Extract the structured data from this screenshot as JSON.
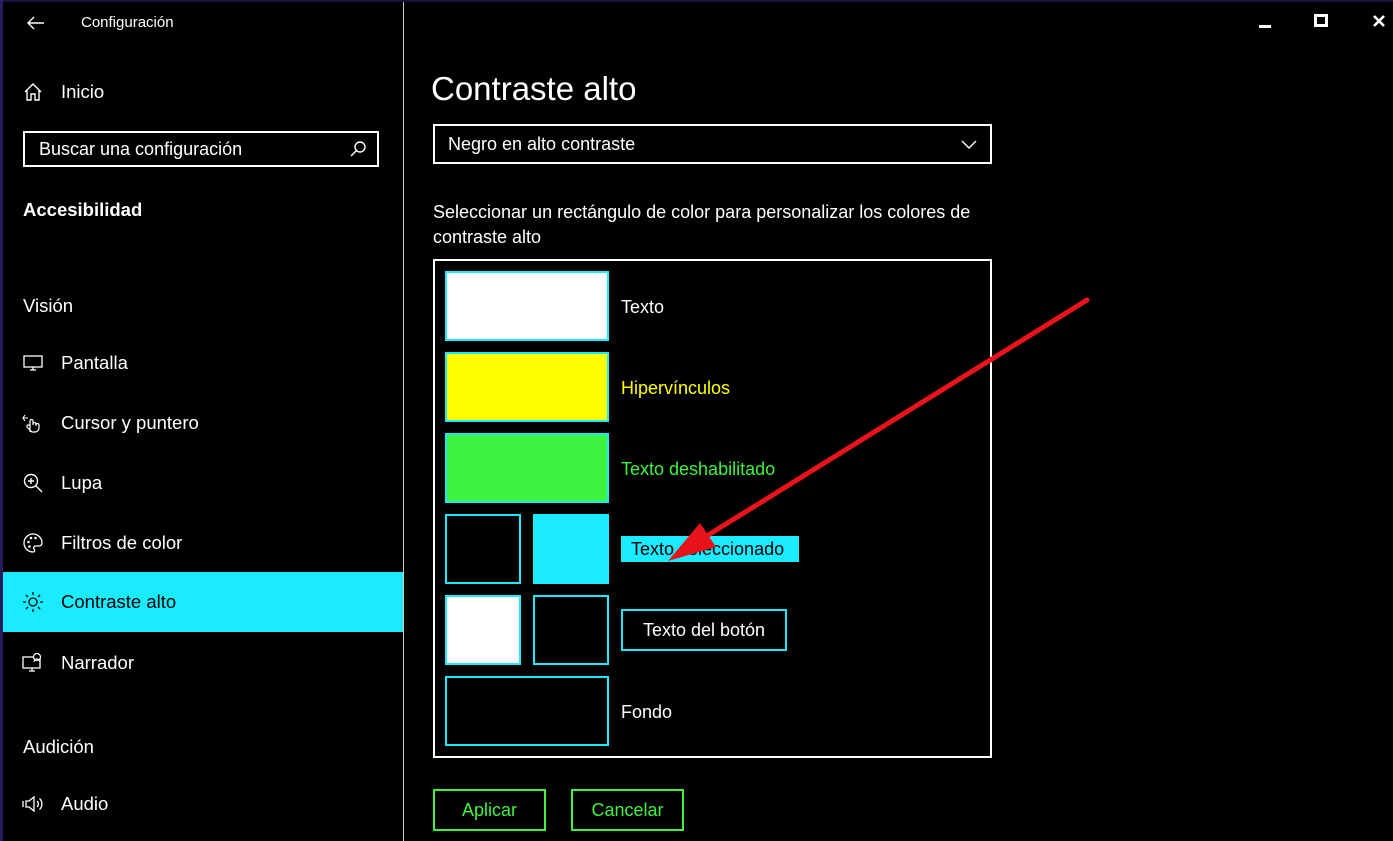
{
  "window": {
    "title": "Configuración",
    "minimize_icon": "minimize-icon",
    "maximize_icon": "maximize-icon",
    "close_icon": "close-icon"
  },
  "sidebar": {
    "home": {
      "label": "Inicio",
      "icon": "home-icon"
    },
    "search": {
      "placeholder": "Buscar una configuración",
      "icon": "search-icon"
    },
    "category": "Accesibilidad",
    "sections": [
      {
        "title": "Visión",
        "items": [
          {
            "label": "Pantalla",
            "icon": "monitor-icon"
          },
          {
            "label": "Cursor y puntero",
            "icon": "pointer-icon"
          },
          {
            "label": "Lupa",
            "icon": "magnifier-icon"
          },
          {
            "label": "Filtros de color",
            "icon": "palette-icon"
          },
          {
            "label": "Contraste alto",
            "icon": "brightness-icon",
            "active": true
          },
          {
            "label": "Narrador",
            "icon": "narrator-icon"
          }
        ]
      },
      {
        "title": "Audición",
        "items": [
          {
            "label": "Audio",
            "icon": "speaker-icon"
          }
        ]
      }
    ]
  },
  "main": {
    "title": "Contraste alto",
    "theme_select": {
      "value": "Negro en alto contraste",
      "icon": "chevron-down-icon"
    },
    "description": "Seleccionar un rectángulo de color para personalizar los colores de contraste alto",
    "colors": [
      {
        "label": "Texto",
        "color": "#ffffff",
        "text_color": "#ffffff"
      },
      {
        "label": "Hipervínculos",
        "color": "#ffff00",
        "text_color": "#ffff00"
      },
      {
        "label": "Texto deshabilitado",
        "color": "#3ff23f",
        "text_color": "#3ff23f"
      },
      {
        "label": "Texto seleccionado",
        "foreground": "#000000",
        "background": "#1aebff"
      },
      {
        "label": "Texto del botón",
        "foreground": "#ffffff",
        "background": "#000000"
      },
      {
        "label": "Fondo",
        "color": "#000000",
        "text_color": "#ffffff"
      }
    ],
    "apply_label": "Aplicar",
    "cancel_label": "Cancelar"
  },
  "theme": {
    "accent": "#1aebff",
    "button_green": "#3ff23f",
    "annotation_arrow": "#e8131b"
  }
}
